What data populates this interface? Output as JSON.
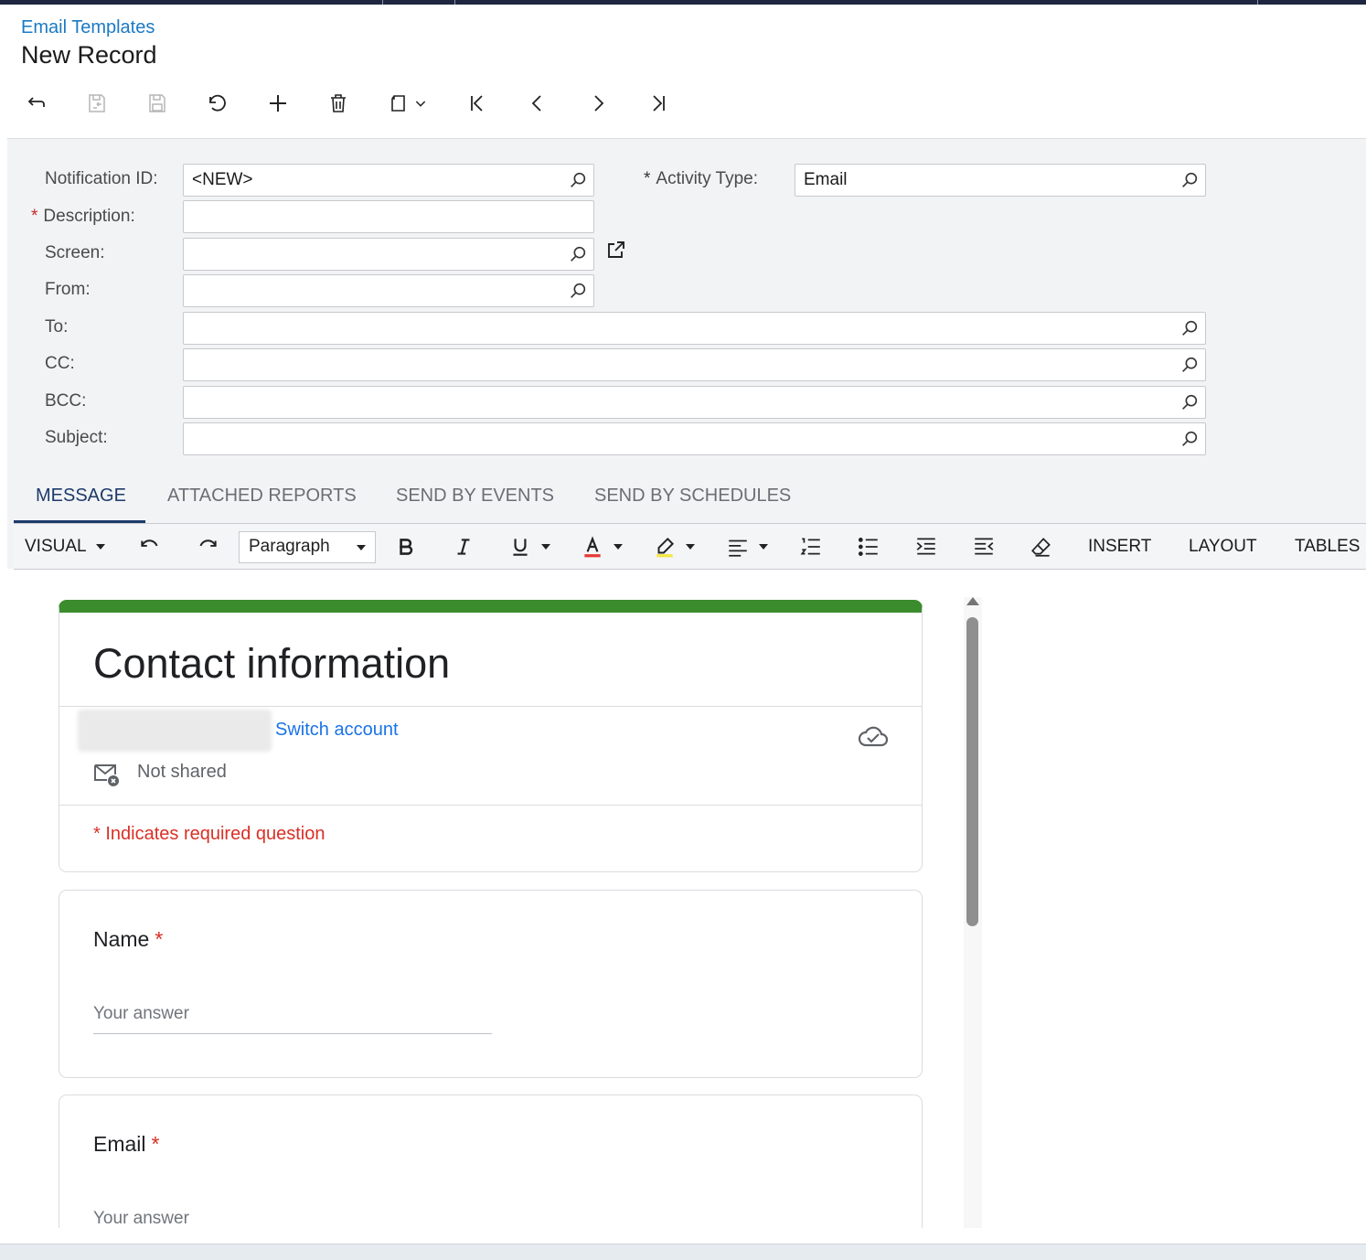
{
  "breadcrumb": "Email Templates",
  "page_title": "New Record",
  "toolbar": {
    "buttons": [
      "back-icon",
      "save-close-icon",
      "save-icon",
      "cancel-icon",
      "add-icon",
      "delete-icon",
      "copy-paste-icon",
      "first-icon",
      "previous-icon",
      "next-icon",
      "last-icon"
    ]
  },
  "form": {
    "notification_id_label": "Notification ID:",
    "notification_id_value": "<NEW>",
    "activity_type_label": "Activity Type:",
    "activity_type_value": "Email",
    "description_label": "Description:",
    "screen_label": "Screen:",
    "from_label": "From:",
    "to_label": "To:",
    "cc_label": "CC:",
    "bcc_label": "BCC:",
    "subject_label": "Subject:",
    "required_marker": "*"
  },
  "tabs": [
    {
      "label": "MESSAGE",
      "active": true
    },
    {
      "label": "ATTACHED REPORTS",
      "active": false
    },
    {
      "label": "SEND BY EVENTS",
      "active": false
    },
    {
      "label": "SEND BY SCHEDULES",
      "active": false
    }
  ],
  "editor": {
    "mode": "VISUAL",
    "block_format": "Paragraph",
    "menu_insert": "INSERT",
    "menu_layout": "LAYOUT",
    "menu_tables": "TABLES"
  },
  "message": {
    "form_title": "Contact information",
    "switch_account": "Switch account",
    "not_shared": "Not shared",
    "required_note": "* Indicates required question",
    "questions": [
      {
        "title": "Name",
        "star": "*",
        "placeholder": "Your answer"
      },
      {
        "title": "Email",
        "star": "*",
        "placeholder": "Your answer"
      }
    ],
    "accent_color": "#3b8c2c"
  }
}
